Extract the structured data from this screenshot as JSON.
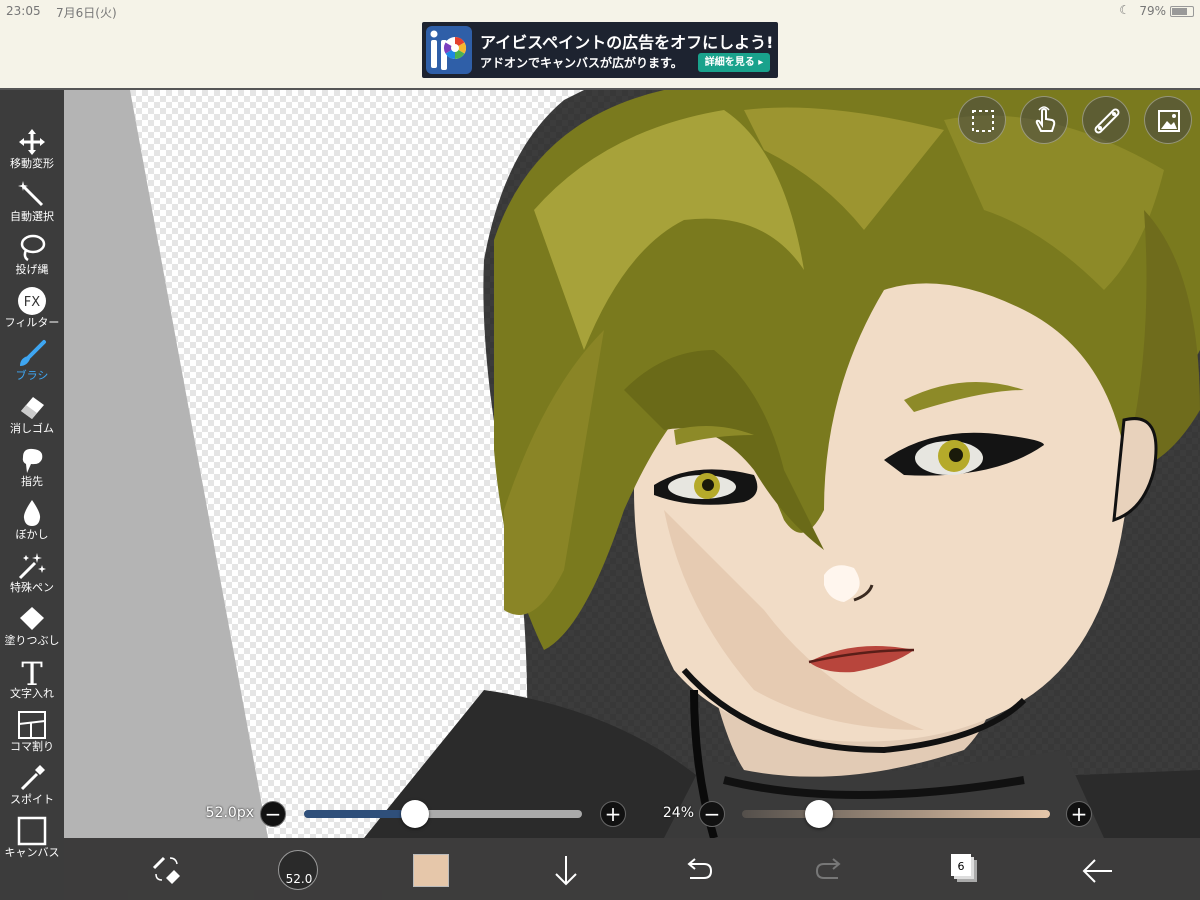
{
  "status_bar": {
    "time": "23:05",
    "date": "7月6日(火)",
    "battery_percent": "79%"
  },
  "ad": {
    "title": "アイビスペイントの広告をオフにしよう!",
    "subtitle": "アドオンでキャンバスが広がります。",
    "button_label": "詳細を見る ▸"
  },
  "toolbar": {
    "items": [
      {
        "label": "移動変形",
        "icon": "move-icon"
      },
      {
        "label": "自動選択",
        "icon": "magic-wand-icon"
      },
      {
        "label": "投げ縄",
        "icon": "lasso-icon"
      },
      {
        "label": "フィルター",
        "icon": "fx-icon"
      },
      {
        "label": "ブラシ",
        "icon": "brush-icon",
        "active": true
      },
      {
        "label": "消しゴム",
        "icon": "eraser-icon"
      },
      {
        "label": "指先",
        "icon": "smudge-icon"
      },
      {
        "label": "ぼかし",
        "icon": "blur-drop-icon"
      },
      {
        "label": "特殊ペン",
        "icon": "special-pen-icon"
      },
      {
        "label": "塗りつぶし",
        "icon": "fill-bucket-icon"
      },
      {
        "label": "文字入れ",
        "icon": "text-icon"
      },
      {
        "label": "コマ割り",
        "icon": "frame-divider-icon"
      },
      {
        "label": "スポイト",
        "icon": "eyedropper-icon"
      },
      {
        "label": "キャンバス",
        "icon": "canvas-icon"
      }
    ]
  },
  "brush_size": {
    "label": "52.0px",
    "button_label": "52.0",
    "value_fraction": 0.4
  },
  "opacity": {
    "label": "24%",
    "value_fraction": 0.25
  },
  "bottom_bar": {
    "layer_count": "6",
    "active_color": "#e6c7aa"
  },
  "colors": {
    "accent": "#3ea6f2",
    "toolbar_bg": "#3c3c3c",
    "size_track": "#2f4f7a"
  },
  "floating_buttons": [
    "selection-icon",
    "hand-touch-icon",
    "ruler-icon",
    "reference-window-icon"
  ]
}
